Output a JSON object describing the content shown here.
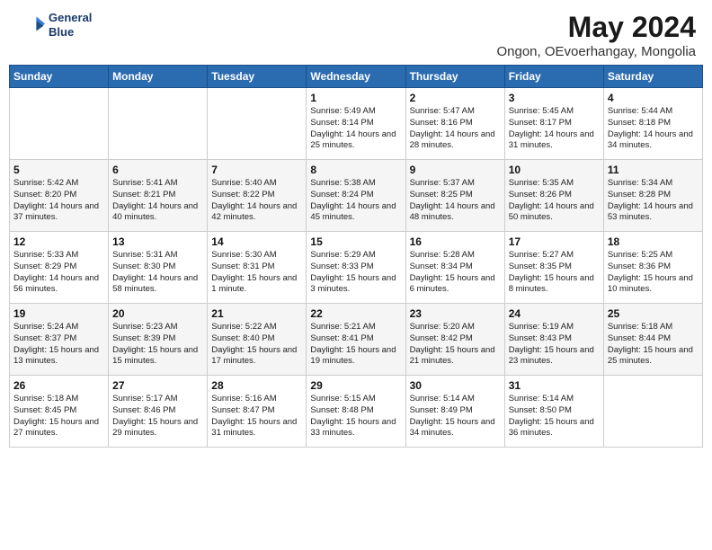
{
  "header": {
    "logo_line1": "General",
    "logo_line2": "Blue",
    "title": "May 2024",
    "subtitle": "Ongon, OEvoerhangay, Mongolia"
  },
  "weekdays": [
    "Sunday",
    "Monday",
    "Tuesday",
    "Wednesday",
    "Thursday",
    "Friday",
    "Saturday"
  ],
  "weeks": [
    [
      {
        "day": "",
        "info": ""
      },
      {
        "day": "",
        "info": ""
      },
      {
        "day": "",
        "info": ""
      },
      {
        "day": "1",
        "info": "Sunrise: 5:49 AM\nSunset: 8:14 PM\nDaylight: 14 hours\nand 25 minutes."
      },
      {
        "day": "2",
        "info": "Sunrise: 5:47 AM\nSunset: 8:16 PM\nDaylight: 14 hours\nand 28 minutes."
      },
      {
        "day": "3",
        "info": "Sunrise: 5:45 AM\nSunset: 8:17 PM\nDaylight: 14 hours\nand 31 minutes."
      },
      {
        "day": "4",
        "info": "Sunrise: 5:44 AM\nSunset: 8:18 PM\nDaylight: 14 hours\nand 34 minutes."
      }
    ],
    [
      {
        "day": "5",
        "info": "Sunrise: 5:42 AM\nSunset: 8:20 PM\nDaylight: 14 hours\nand 37 minutes."
      },
      {
        "day": "6",
        "info": "Sunrise: 5:41 AM\nSunset: 8:21 PM\nDaylight: 14 hours\nand 40 minutes."
      },
      {
        "day": "7",
        "info": "Sunrise: 5:40 AM\nSunset: 8:22 PM\nDaylight: 14 hours\nand 42 minutes."
      },
      {
        "day": "8",
        "info": "Sunrise: 5:38 AM\nSunset: 8:24 PM\nDaylight: 14 hours\nand 45 minutes."
      },
      {
        "day": "9",
        "info": "Sunrise: 5:37 AM\nSunset: 8:25 PM\nDaylight: 14 hours\nand 48 minutes."
      },
      {
        "day": "10",
        "info": "Sunrise: 5:35 AM\nSunset: 8:26 PM\nDaylight: 14 hours\nand 50 minutes."
      },
      {
        "day": "11",
        "info": "Sunrise: 5:34 AM\nSunset: 8:28 PM\nDaylight: 14 hours\nand 53 minutes."
      }
    ],
    [
      {
        "day": "12",
        "info": "Sunrise: 5:33 AM\nSunset: 8:29 PM\nDaylight: 14 hours\nand 56 minutes."
      },
      {
        "day": "13",
        "info": "Sunrise: 5:31 AM\nSunset: 8:30 PM\nDaylight: 14 hours\nand 58 minutes."
      },
      {
        "day": "14",
        "info": "Sunrise: 5:30 AM\nSunset: 8:31 PM\nDaylight: 15 hours\nand 1 minute."
      },
      {
        "day": "15",
        "info": "Sunrise: 5:29 AM\nSunset: 8:33 PM\nDaylight: 15 hours\nand 3 minutes."
      },
      {
        "day": "16",
        "info": "Sunrise: 5:28 AM\nSunset: 8:34 PM\nDaylight: 15 hours\nand 6 minutes."
      },
      {
        "day": "17",
        "info": "Sunrise: 5:27 AM\nSunset: 8:35 PM\nDaylight: 15 hours\nand 8 minutes."
      },
      {
        "day": "18",
        "info": "Sunrise: 5:25 AM\nSunset: 8:36 PM\nDaylight: 15 hours\nand 10 minutes."
      }
    ],
    [
      {
        "day": "19",
        "info": "Sunrise: 5:24 AM\nSunset: 8:37 PM\nDaylight: 15 hours\nand 13 minutes."
      },
      {
        "day": "20",
        "info": "Sunrise: 5:23 AM\nSunset: 8:39 PM\nDaylight: 15 hours\nand 15 minutes."
      },
      {
        "day": "21",
        "info": "Sunrise: 5:22 AM\nSunset: 8:40 PM\nDaylight: 15 hours\nand 17 minutes."
      },
      {
        "day": "22",
        "info": "Sunrise: 5:21 AM\nSunset: 8:41 PM\nDaylight: 15 hours\nand 19 minutes."
      },
      {
        "day": "23",
        "info": "Sunrise: 5:20 AM\nSunset: 8:42 PM\nDaylight: 15 hours\nand 21 minutes."
      },
      {
        "day": "24",
        "info": "Sunrise: 5:19 AM\nSunset: 8:43 PM\nDaylight: 15 hours\nand 23 minutes."
      },
      {
        "day": "25",
        "info": "Sunrise: 5:18 AM\nSunset: 8:44 PM\nDaylight: 15 hours\nand 25 minutes."
      }
    ],
    [
      {
        "day": "26",
        "info": "Sunrise: 5:18 AM\nSunset: 8:45 PM\nDaylight: 15 hours\nand 27 minutes."
      },
      {
        "day": "27",
        "info": "Sunrise: 5:17 AM\nSunset: 8:46 PM\nDaylight: 15 hours\nand 29 minutes."
      },
      {
        "day": "28",
        "info": "Sunrise: 5:16 AM\nSunset: 8:47 PM\nDaylight: 15 hours\nand 31 minutes."
      },
      {
        "day": "29",
        "info": "Sunrise: 5:15 AM\nSunset: 8:48 PM\nDaylight: 15 hours\nand 33 minutes."
      },
      {
        "day": "30",
        "info": "Sunrise: 5:14 AM\nSunset: 8:49 PM\nDaylight: 15 hours\nand 34 minutes."
      },
      {
        "day": "31",
        "info": "Sunrise: 5:14 AM\nSunset: 8:50 PM\nDaylight: 15 hours\nand 36 minutes."
      },
      {
        "day": "",
        "info": ""
      }
    ]
  ]
}
